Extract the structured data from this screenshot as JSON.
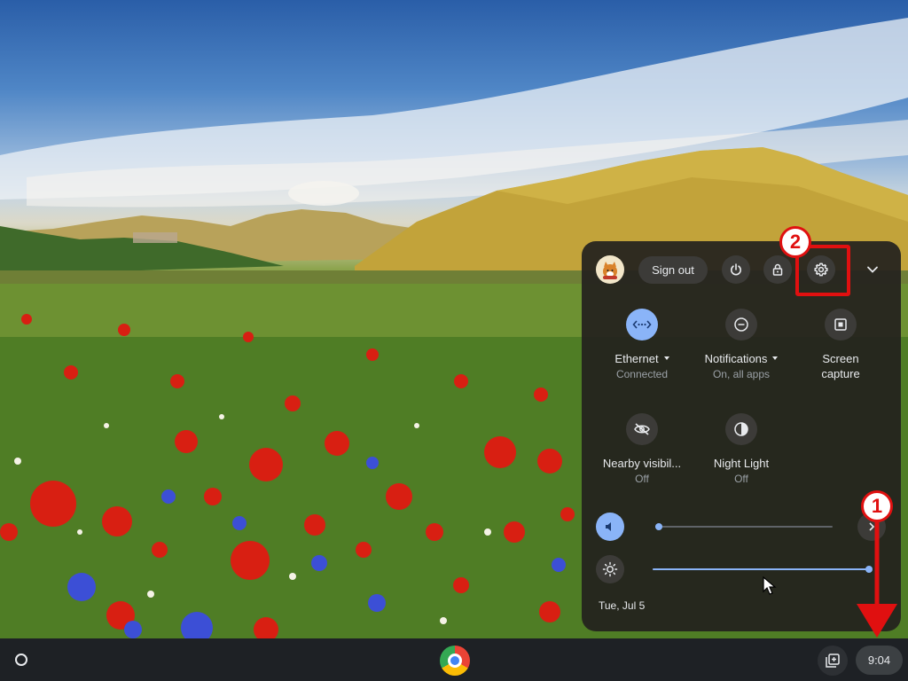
{
  "quick_settings": {
    "sign_out_label": "Sign out",
    "tiles": [
      {
        "label": "Ethernet",
        "sublabel": "Connected",
        "icon": "ethernet-icon",
        "active": true,
        "has_dropdown": true
      },
      {
        "label": "Notifications",
        "sublabel": "On, all apps",
        "icon": "do-not-disturb-icon",
        "active": false,
        "has_dropdown": true
      },
      {
        "label": "Screen",
        "label_line2": "capture",
        "icon": "screen-capture-icon",
        "active": false
      },
      {
        "label": "Nearby visibil...",
        "sublabel": "Off",
        "icon": "nearby-visibility-off-icon",
        "active": false
      },
      {
        "label": "Night Light",
        "sublabel": "Off",
        "icon": "night-light-icon",
        "active": false
      }
    ],
    "volume_level": 0.02,
    "brightness_level": 1.0,
    "date": "Tue, Jul 5"
  },
  "shelf": {
    "time": "9:04",
    "apps": [
      "chrome-icon"
    ]
  },
  "annotations": {
    "step1": "1",
    "step2": "2"
  },
  "colors": {
    "accent": "#8ab4f8",
    "panel_bg": "#23211e",
    "annotation_red": "#e01010"
  }
}
